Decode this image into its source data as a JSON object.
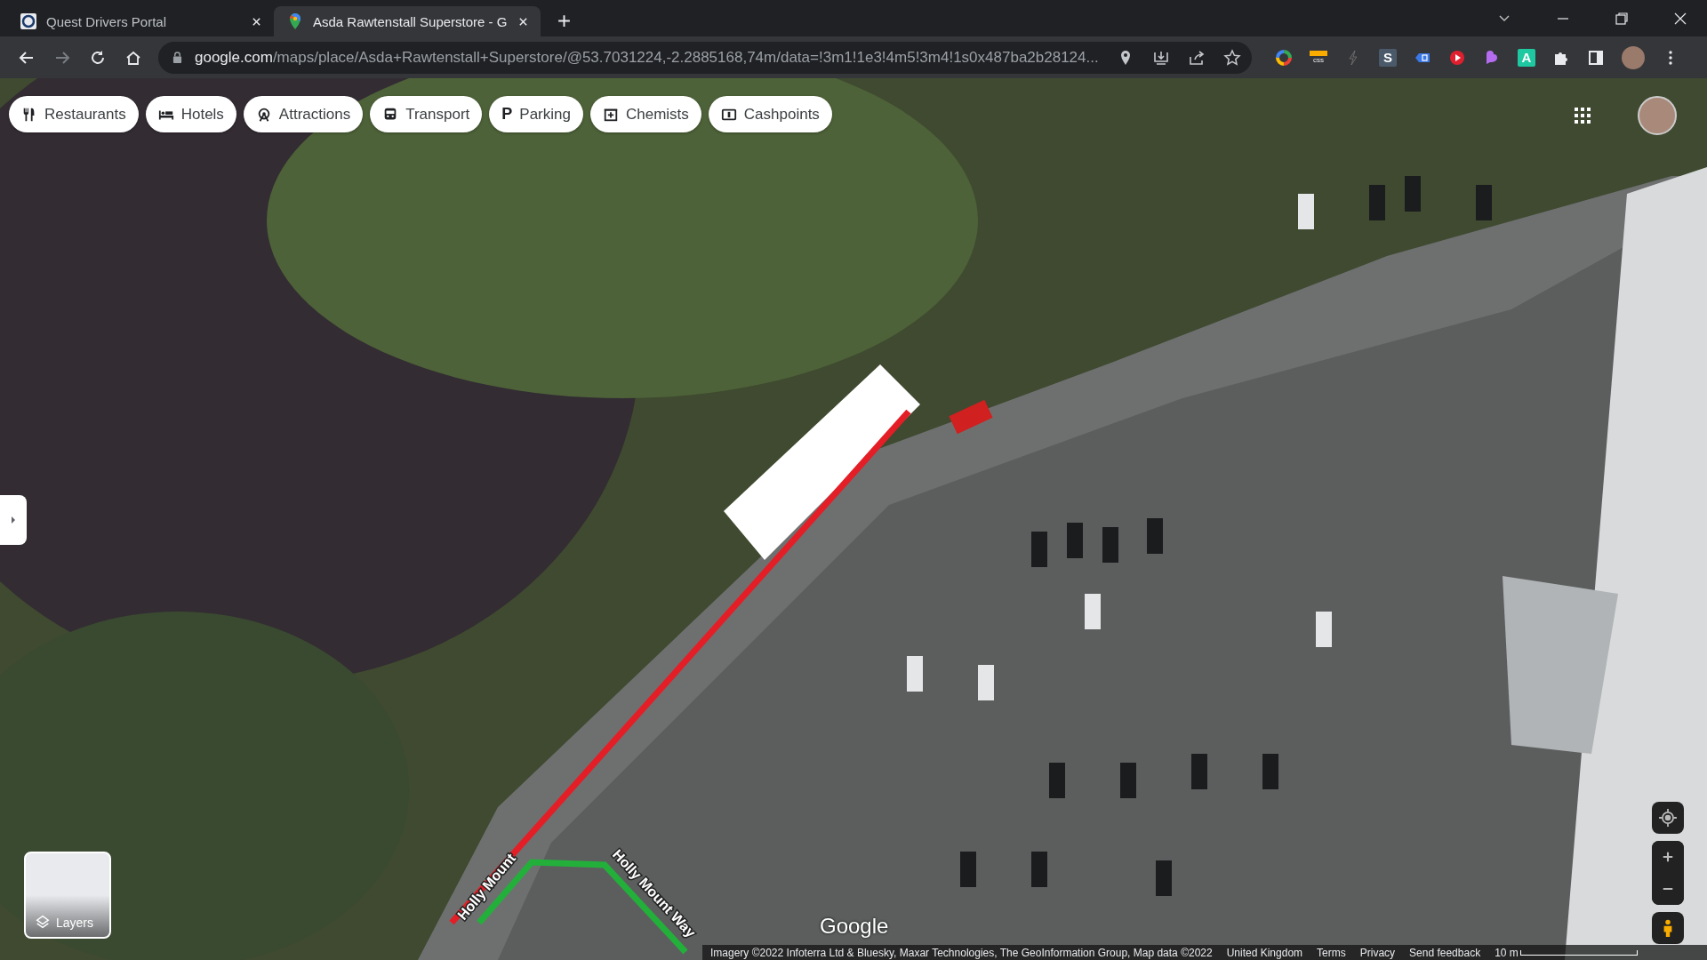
{
  "browser": {
    "tabs": [
      {
        "title": "Quest Drivers Portal",
        "kind": "portal",
        "selected": false
      },
      {
        "title": "Asda Rawtenstall Superstore - G",
        "kind": "maps",
        "selected": true
      }
    ],
    "address": {
      "host": "google.com",
      "path": "/maps/place/Asda+Rawtenstall+Superstore/@53.7031224,-2.2885168,74m/data=!3m1!1e3!4m5!3m4!1s0x487ba2b28124..."
    },
    "extensions": [
      {
        "kind": "color-wheel"
      },
      {
        "kind": "css",
        "label": "css"
      },
      {
        "kind": "bolt"
      },
      {
        "kind": "letter",
        "label": "S",
        "color": "#4a5a6a"
      },
      {
        "kind": "tag"
      },
      {
        "kind": "play"
      },
      {
        "kind": "petal"
      },
      {
        "kind": "letter",
        "label": "A",
        "color": "#1ec8a0"
      },
      {
        "kind": "puzzle"
      },
      {
        "kind": "sidepanel"
      }
    ]
  },
  "map": {
    "categories": [
      {
        "label": "Restaurants",
        "kind": "restaurant"
      },
      {
        "label": "Hotels",
        "kind": "hotel"
      },
      {
        "label": "Attractions",
        "kind": "attraction"
      },
      {
        "label": "Transport",
        "kind": "transport"
      },
      {
        "label": "Parking",
        "kind": "parking",
        "icon_text": "P"
      },
      {
        "label": "Chemists",
        "kind": "chemist"
      },
      {
        "label": "Cashpoints",
        "kind": "cash"
      }
    ],
    "road_labels": [
      {
        "text": "Holly Mount",
        "kind": "left"
      },
      {
        "text": "Holly Mount Way",
        "kind": "right"
      }
    ],
    "layers_label": "Layers",
    "logo": "Google",
    "footer": {
      "attribution": "Imagery ©2022 Infoterra Ltd & Bluesky, Maxar Technologies, The GeoInformation Group, Map data ©2022",
      "links": [
        "United Kingdom",
        "Terms",
        "Privacy",
        "Send feedback"
      ],
      "scale": "10 m"
    }
  }
}
